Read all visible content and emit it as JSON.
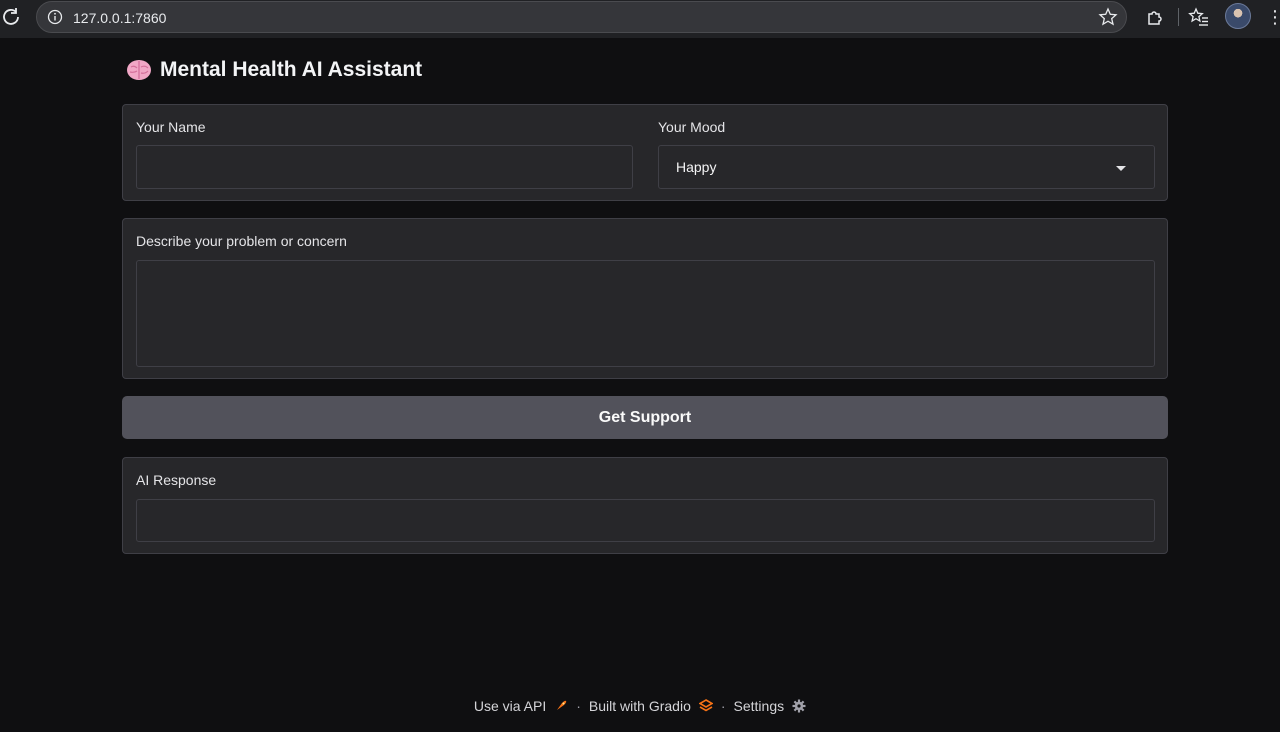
{
  "browser": {
    "url": "127.0.0.1:7860"
  },
  "app": {
    "title": "Mental Health AI Assistant"
  },
  "form": {
    "name_label": "Your Name",
    "name_value": "",
    "mood_label": "Your Mood",
    "mood_value": "Happy",
    "problem_label": "Describe your problem or concern",
    "problem_value": "",
    "submit_label": "Get Support",
    "response_label": "AI Response",
    "response_value": ""
  },
  "footer": {
    "api_label": "Use via API",
    "gradio_label": "Built with Gradio",
    "settings_label": "Settings",
    "separator": "·"
  },
  "colors": {
    "background": "#0f0f11",
    "panel": "#27272a",
    "button": "#52525b",
    "gradio_orange": "#f97316"
  }
}
